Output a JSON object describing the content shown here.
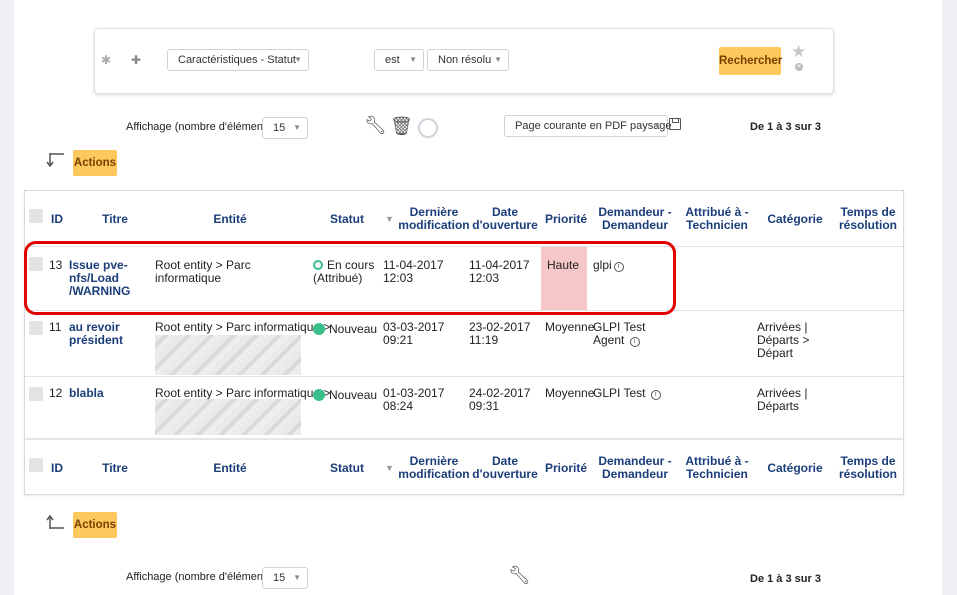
{
  "search": {
    "field_label": "Caractéristiques - Statut",
    "operator": "est",
    "value": "Non résolu",
    "search_button": "Rechercher"
  },
  "pager_top": {
    "display_label": "Affichage (nombre d'éléments)",
    "page_size": "15",
    "export_option": "Page courante en PDF paysage",
    "range": "De 1 à 3 sur 3"
  },
  "pager_bottom": {
    "display_label": "Affichage (nombre d'éléments)",
    "page_size": "15",
    "range": "De 1 à 3 sur 3"
  },
  "actions_label": "Actions",
  "columns": {
    "id": "ID",
    "title": "Titre",
    "entity": "Entité",
    "status": "Statut",
    "last_mod": "Dernière modification",
    "opened": "Date d'ouverture",
    "priority": "Priorité",
    "requester": "Demandeur - Demandeur",
    "assigned": "Attribué à - Technicien",
    "category": "Catégorie",
    "resolution": "Temps de résolution"
  },
  "rows": [
    {
      "id": "13",
      "title": "Issue pve-nfs/Load /WARNING",
      "entity": "Root entity > Parc informatique",
      "status": "En cours (Attribué)",
      "last_mod": "11-04-2017 12:03",
      "opened": "11-04-2017 12:03",
      "priority": "Haute",
      "requester": "glpi",
      "assigned": "",
      "category": "",
      "resolution": ""
    },
    {
      "id": "11",
      "title": "au revoir président",
      "entity": "Root entity > Parc informatique >",
      "status": "Nouveau",
      "last_mod": "03-03-2017 09:21",
      "opened": "23-02-2017 11:19",
      "priority": "Moyenne",
      "requester": "GLPI Test Agent",
      "assigned": "",
      "category": "Arrivées | Départs > Départ",
      "resolution": ""
    },
    {
      "id": "12",
      "title": "blabla",
      "entity": "Root entity > Parc informatique >",
      "status": "Nouveau",
      "last_mod": "01-03-2017 08:24",
      "opened": "24-02-2017 09:31",
      "priority": "Moyenne",
      "requester": "GLPI Test",
      "assigned": "",
      "category": "Arrivées | Départs",
      "resolution": ""
    }
  ],
  "colors": {
    "accent_yellow": "#fec95c",
    "header_blue": "#1b3d7a",
    "priority_bg": "#f6c7c7",
    "status_green": "#3bbf8a",
    "highlight_red": "#e00000"
  }
}
